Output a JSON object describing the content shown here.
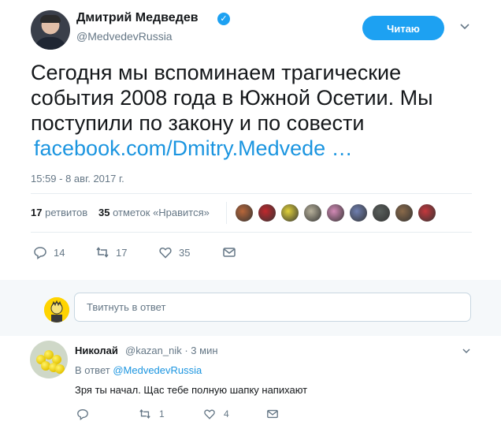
{
  "header": {
    "display_name": "Дмитрий Медведев",
    "handle": "@MedvedevRussia",
    "follow_label": "Читаю",
    "verified_icon": "verified-badge-icon",
    "more_icon": "chevron-down-icon"
  },
  "tweet": {
    "text": "Сегодня мы вспоминаем трагические\nсобытия 2008 года в Южной Осетии. Мы\nпоступили по закону и по совести",
    "link": "facebook.com/Dmitry.Medvede …",
    "timestamp": "15:59 - 8 авг. 2017 г.",
    "stats": {
      "retweets_count": "17",
      "retweets_label": "ретвитов",
      "likes_count": "35",
      "likes_label": "отметок «Нравится»"
    },
    "liker_avatars": [
      "#b8673a",
      "#c0282d",
      "#e1d23a",
      "#b6b09a",
      "#d38ab6",
      "#6f7fb0",
      "#595f5c",
      "#8a6a4a",
      "#c4383d"
    ],
    "actions": {
      "replies": "14",
      "retweets": "17",
      "likes": "35"
    }
  },
  "composer": {
    "placeholder": "Твитнуть в ответ"
  },
  "reply": {
    "name": "Николай",
    "handle_time": "@kazan_nik · 3 мин",
    "in_reply_prefix": "В ответ",
    "in_reply_handle": "@MedvedevRussia",
    "text": "Зря ты начал. Щас тебе полную шапку напихают",
    "actions": {
      "replies": "",
      "retweets": "1",
      "likes": "4"
    }
  },
  "colors": {
    "accent": "#1da1f2",
    "link": "#1b95e0",
    "muted": "#657786",
    "band": "#f5f8fa"
  }
}
